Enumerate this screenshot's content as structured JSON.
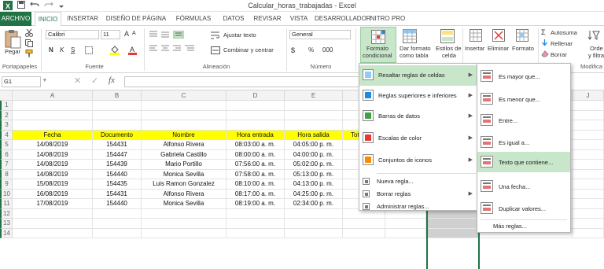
{
  "app": {
    "title": "Calcular_horas_trabajadas - Excel"
  },
  "tabs": [
    {
      "label": "ARCHIVO",
      "state": "file"
    },
    {
      "label": "INICIO",
      "state": "active"
    },
    {
      "label": "INSERTAR",
      "state": ""
    },
    {
      "label": "DISEÑO DE PÁGINA",
      "state": ""
    },
    {
      "label": "FÓRMULAS",
      "state": ""
    },
    {
      "label": "DATOS",
      "state": ""
    },
    {
      "label": "REVISAR",
      "state": ""
    },
    {
      "label": "VISTA",
      "state": ""
    },
    {
      "label": "DESARROLLADOR",
      "state": ""
    },
    {
      "label": "NITRO PRO",
      "state": ""
    }
  ],
  "ribbon": {
    "paste": "Pegar",
    "clipboard_group": "Portapapeles",
    "font_name": "Calibri",
    "font_size": "11",
    "bold": "N",
    "italic": "K",
    "underline": "S",
    "font_group": "Fuente",
    "wrap_text": "Ajustar texto",
    "merge_center": "Combinar y centrar",
    "alignment_group": "Alineación",
    "number_format": "General",
    "number_group": "Número",
    "cond_format_1": "Formato",
    "cond_format_2": "condicional",
    "table_format_1": "Dar formato",
    "table_format_2": "como tabla",
    "cell_styles_1": "Estilos de",
    "cell_styles_2": "celda",
    "insert": "Insertar",
    "delete": "Eliminar",
    "format": "Formato",
    "autosum": "Autosuma",
    "fill": "Rellenar",
    "clear": "Borrar",
    "sort_1": "Orde",
    "sort_2": "y filtra",
    "modify_group": "Modifica"
  },
  "formula_bar": {
    "name_box": "G1",
    "fx": "fx"
  },
  "columns": [
    "A",
    "B",
    "C",
    "D",
    "E",
    "F",
    "G",
    "H",
    "I",
    "J"
  ],
  "rows": [
    "1",
    "2",
    "3",
    "4",
    "5",
    "6",
    "7",
    "8",
    "9",
    "10",
    "11",
    "12",
    "13",
    "14"
  ],
  "table": {
    "headers": [
      "Fecha",
      "Documento",
      "Nombre",
      "Hora entrada",
      "Hora salida",
      "Tot"
    ],
    "data": [
      [
        "14/08/2019",
        "154431",
        "Alfonso Rivera",
        "08:03:00 a. m.",
        "04:05:00 p. m."
      ],
      [
        "14/08/2019",
        "154447",
        "Gabriela Castillo",
        "08:00:00 a. m.",
        "04:00:00 p. m."
      ],
      [
        "14/08/2019",
        "154439",
        "Mario Portillo",
        "07:56:00 a. m.",
        "05:02:00 p. m."
      ],
      [
        "14/08/2019",
        "154440",
        "Monica Sevilla",
        "07:58:00 a. m.",
        "05:13:00 p. m."
      ],
      [
        "15/08/2019",
        "154435",
        "Luis Ramon Gonzalez",
        "08:10:00 a. m.",
        "04:13:00 p. m."
      ],
      [
        "16/08/2019",
        "154431",
        "Alfonso Rivera",
        "08:17:00 a. m.",
        "04:25:00 p. m."
      ],
      [
        "17/08/2019",
        "154440",
        "Monica Sevilla",
        "08:19:00 a. m.",
        "02:34:00 p. m."
      ]
    ]
  },
  "cf_menu": [
    {
      "label": "Resaltar reglas de celdas",
      "submenu": true,
      "highlight": true
    },
    {
      "label": "Reglas superiores e inferiores",
      "submenu": true,
      "highlight": false
    },
    {
      "label": "Barras de datos",
      "submenu": true,
      "highlight": false
    },
    {
      "label": "Escalas de color",
      "submenu": true,
      "highlight": false
    },
    {
      "label": "Conjuntos de iconos",
      "submenu": true,
      "highlight": false
    },
    {
      "label": "Nueva regla...",
      "submenu": false,
      "highlight": false
    },
    {
      "label": "Borrar reglas",
      "submenu": true,
      "highlight": false
    },
    {
      "label": "Administrar reglas...",
      "submenu": false,
      "highlight": false
    }
  ],
  "highlight_menu": [
    {
      "label": "Es mayor que...",
      "highlight": false
    },
    {
      "label": "Es menor que...",
      "highlight": false
    },
    {
      "label": "Entre...",
      "highlight": false
    },
    {
      "label": "Es igual a...",
      "highlight": false
    },
    {
      "label": "Texto que contiene...",
      "highlight": true
    },
    {
      "label": "Una fecha...",
      "highlight": false
    },
    {
      "label": "Duplicar valores...",
      "highlight": false
    }
  ],
  "more_rules": "Más reglas...",
  "colors": {
    "excel_green": "#217346",
    "header_yellow": "#ffff00",
    "menu_highlight": "#c8e6c9",
    "selection_gray": "#d0d0d0",
    "bar_red": "#e57373"
  }
}
